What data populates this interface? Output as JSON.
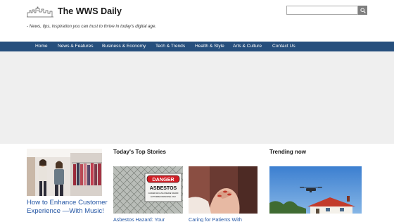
{
  "site": {
    "title": "The WWS Daily",
    "tagline": "- News, tips, inspiration you can trust to thrive in today's digital age."
  },
  "search": {
    "placeholder": "",
    "button_icon": "search-icon"
  },
  "nav": {
    "items": [
      {
        "label": "Home"
      },
      {
        "label": "News & Features"
      },
      {
        "label": "Business & Economy"
      },
      {
        "label": "Tech & Trends"
      },
      {
        "label": "Health & Style"
      },
      {
        "label": "Arts & Culture"
      },
      {
        "label": "Contact Us"
      }
    ]
  },
  "feature": {
    "title": "How to Enhance Customer Experience —With Music!"
  },
  "top_stories": {
    "heading": "Today's Top Stories",
    "items": [
      {
        "title": "Asbestos Hazard: Your",
        "sign_line1": "DANGER",
        "sign_line2": "ASBESTOS",
        "sign_line3": "CANCER AND LUNG DISEASE HAZARD",
        "sign_line4": "AUTHORIZED PERSONNEL ONLY"
      },
      {
        "title": "Caring for Patients With"
      }
    ]
  },
  "trending": {
    "heading": "Trending now"
  },
  "colors": {
    "nav_bg": "#264f7d",
    "link": "#2456a4",
    "hero_bg": "#efefef"
  }
}
